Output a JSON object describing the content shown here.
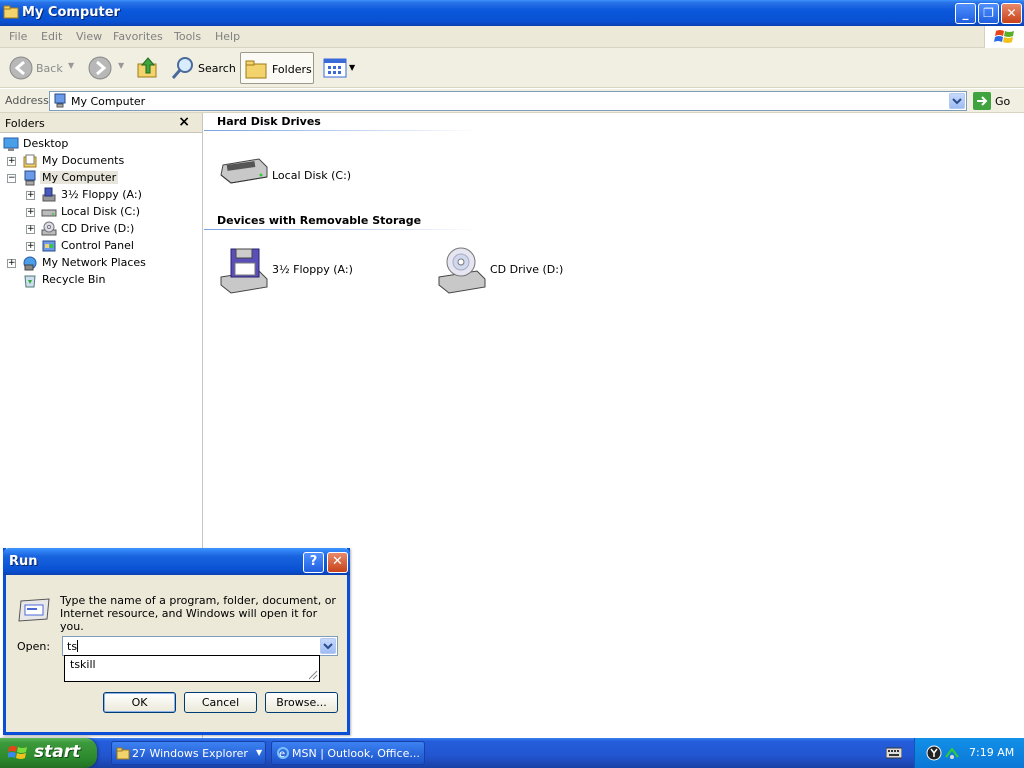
{
  "window": {
    "title": "My Computer"
  },
  "menu": [
    "File",
    "Edit",
    "View",
    "Favorites",
    "Tools",
    "Help"
  ],
  "toolbar": {
    "back": "Back",
    "search": "Search",
    "folders": "Folders"
  },
  "address": {
    "label": "Address",
    "value": "My Computer",
    "go": "Go"
  },
  "folderpane": {
    "title": "Folders",
    "tree": [
      {
        "label": "Desktop",
        "icon": "desktop-icon"
      },
      {
        "label": "My Documents",
        "icon": "my-documents-icon"
      },
      {
        "label": "My Computer",
        "icon": "my-computer-icon",
        "selected": true
      },
      {
        "label": "3½ Floppy (A:)",
        "icon": "floppy-icon"
      },
      {
        "label": "Local Disk (C:)",
        "icon": "hard-disk-icon"
      },
      {
        "label": "CD Drive (D:)",
        "icon": "cd-drive-icon"
      },
      {
        "label": "Control Panel",
        "icon": "control-panel-icon"
      },
      {
        "label": "My Network Places",
        "icon": "network-places-icon"
      },
      {
        "label": "Recycle Bin",
        "icon": "recycle-bin-icon"
      }
    ]
  },
  "content": {
    "groups": [
      {
        "title": "Hard Disk Drives",
        "items": [
          {
            "label": "Local Disk (C:)",
            "icon": "hard-disk-icon"
          }
        ]
      },
      {
        "title": "Devices with Removable Storage",
        "items": [
          {
            "label": "3½ Floppy (A:)",
            "icon": "floppy-drive-icon"
          },
          {
            "label": "CD Drive (D:)",
            "icon": "cd-drive-icon"
          }
        ]
      }
    ]
  },
  "run_dialog": {
    "title": "Run",
    "description_line1": "Type the name of a program, folder, document, or",
    "description_line2": "Internet resource, and Windows will open it for you.",
    "open_label": "Open:",
    "open_value": "ts",
    "suggestion": "tskill",
    "ok": "OK",
    "cancel": "Cancel",
    "browse": "Browse..."
  },
  "taskbar": {
    "start": "start",
    "items": [
      "27 Windows Explorer",
      "MSN | Outlook, Office..."
    ],
    "clock": "7:19 AM"
  }
}
